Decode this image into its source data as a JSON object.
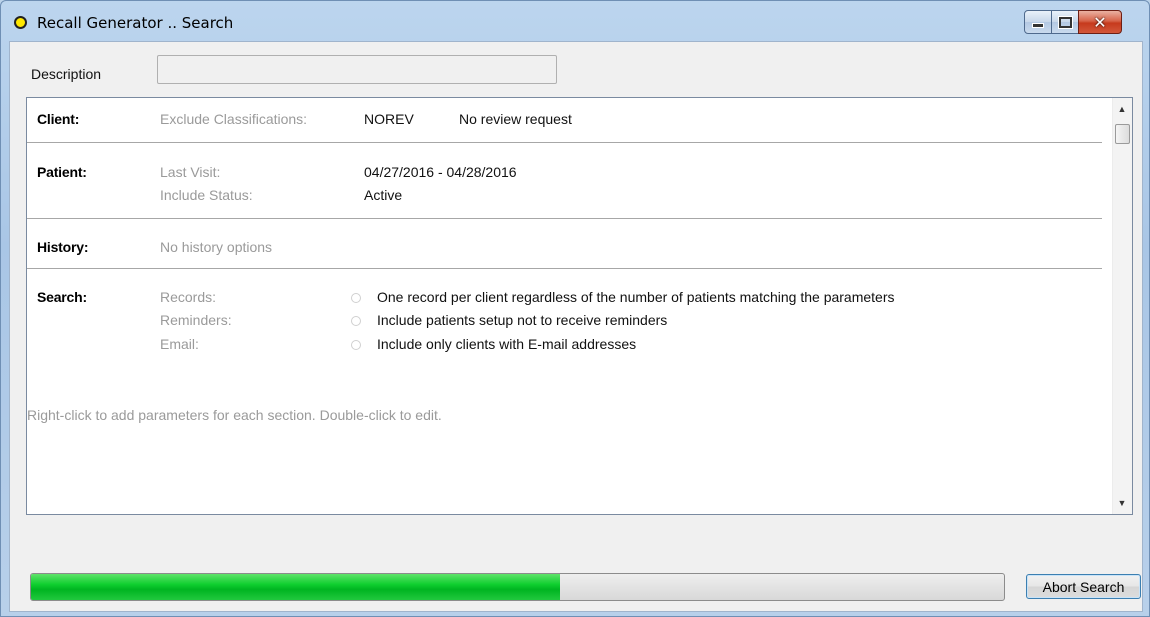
{
  "window": {
    "title": "Recall Generator .. Search"
  },
  "description": {
    "label": "Description",
    "value": ""
  },
  "sections": {
    "client": {
      "title": "Client:",
      "rows": [
        {
          "label": "Exclude Classifications:",
          "code": "NOREV",
          "value": "No review request"
        }
      ]
    },
    "patient": {
      "title": "Patient:",
      "rows": [
        {
          "label": "Last Visit:",
          "value": "04/27/2016 - 04/28/2016"
        },
        {
          "label": "Include Status:",
          "value": "Active"
        }
      ]
    },
    "history": {
      "title": "History:",
      "text": "No history options"
    },
    "search": {
      "title": "Search:",
      "rows": [
        {
          "label": "Records:",
          "value": "One record per client regardless of the number of patients matching the parameters"
        },
        {
          "label": "Reminders:",
          "value": "Include patients setup not to receive reminders"
        },
        {
          "label": "Email:",
          "value": "Include only clients with E-mail addresses"
        }
      ]
    }
  },
  "hint": "Right-click to add parameters for each section. Double-click to edit.",
  "progress": {
    "fraction": 0.544
  },
  "abort_button": {
    "label": "Abort Search"
  },
  "colors": {
    "progress_fill": "#00b521",
    "title_icon": "#ffe800"
  }
}
